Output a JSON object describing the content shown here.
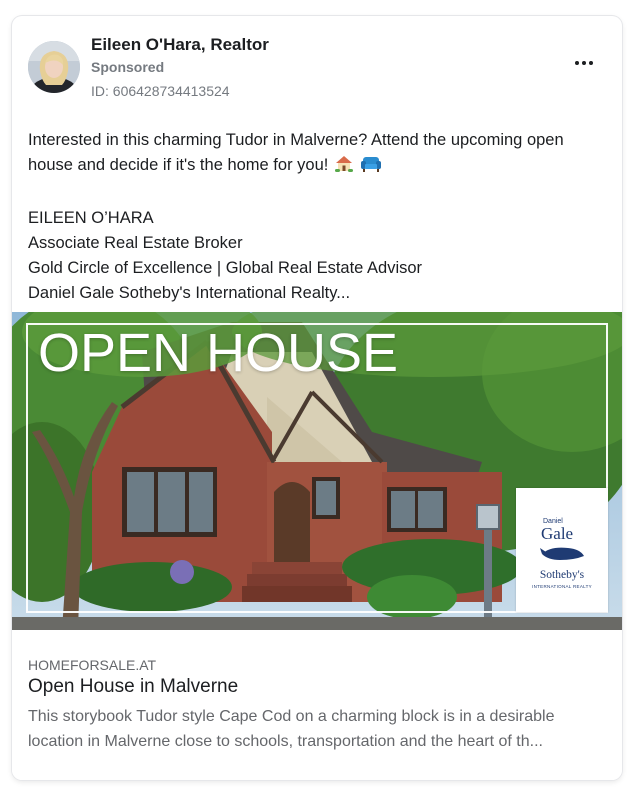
{
  "post": {
    "author": "Eileen O'Hara, Realtor",
    "sponsored_label": "Sponsored",
    "ad_id": "ID: 606428734413524",
    "more_icon": "more-horizontal-icon"
  },
  "body": {
    "line1": "Interested in this charming Tudor in Malverne? Attend the upcoming open",
    "line2": "house and decide if it's the home for you!",
    "emoji_icons": [
      "house-with-garden-icon",
      "couch-icon"
    ],
    "line3": "EILEEN O’HARA",
    "line4": "Associate Real Estate Broker",
    "line5": "Gold Circle of Excellence | Global Real Estate Advisor",
    "line6": "Daniel Gale Sotheby's International Realty..."
  },
  "media": {
    "overlay_title": "OPEN HOUSE",
    "logo": {
      "small": "Daniel",
      "name": "Gale",
      "brand": "Sotheby's",
      "sub": "INTERNATIONAL REALTY"
    }
  },
  "link": {
    "domain": "HOMEFORSALE.AT",
    "title": "Open House in Malverne",
    "desc1": "This storybook Tudor style Cape Cod on a charming block is in a desirable",
    "desc2": "location in Malverne close to schools, transportation and the heart of th..."
  },
  "colors": {
    "text": "#1c1e21",
    "secondary": "#65676b",
    "brick": "#9a4a3a",
    "logo_blue": "#1f3b73"
  }
}
